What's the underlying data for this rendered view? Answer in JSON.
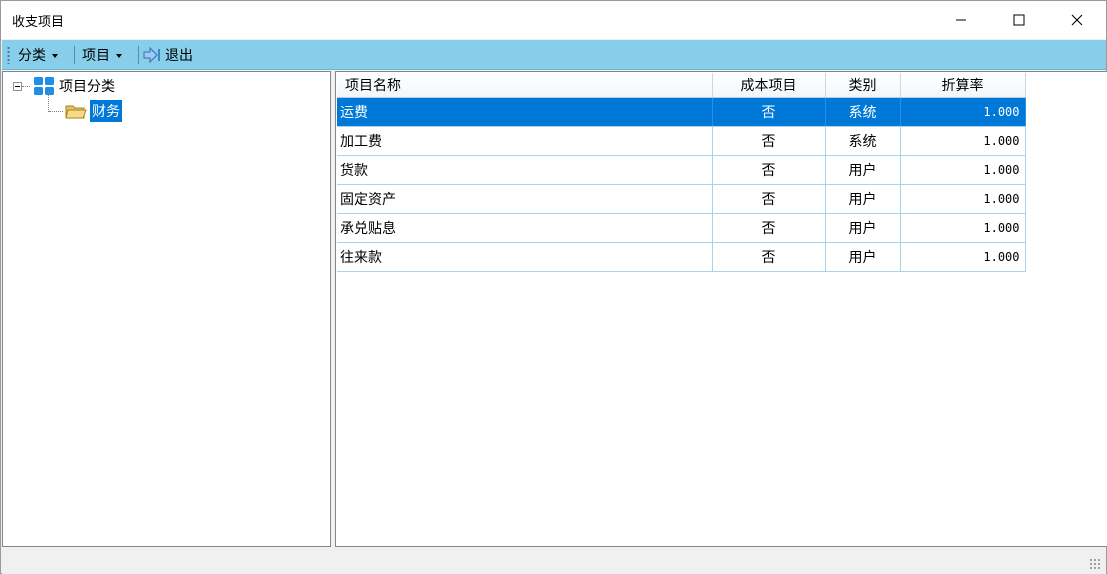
{
  "window": {
    "title": "收支项目"
  },
  "toolbar": {
    "category_label": "分类",
    "item_label": "项目",
    "exit_label": "退出"
  },
  "tree": {
    "root_label": "项目分类",
    "child_label": "财务"
  },
  "grid": {
    "columns": [
      "项目名称",
      "成本项目",
      "类别",
      "折算率"
    ],
    "rows": [
      {
        "name": "运费",
        "cost": "否",
        "type": "系统",
        "rate": "1.000",
        "selected": true
      },
      {
        "name": "加工费",
        "cost": "否",
        "type": "系统",
        "rate": "1.000"
      },
      {
        "name": "货款",
        "cost": "否",
        "type": "用户",
        "rate": "1.000"
      },
      {
        "name": "固定资产",
        "cost": "否",
        "type": "用户",
        "rate": "1.000"
      },
      {
        "name": "承兑贴息",
        "cost": "否",
        "type": "用户",
        "rate": "1.000"
      },
      {
        "name": "往来款",
        "cost": "否",
        "type": "用户",
        "rate": "1.000"
      }
    ]
  },
  "colors": {
    "toolbar_bg": "#87ceeb",
    "selection": "#0078d7"
  },
  "icons": [
    "minimize-icon",
    "maximize-icon",
    "close-icon",
    "exit-icon",
    "category-grid-icon",
    "folder-open-icon"
  ]
}
